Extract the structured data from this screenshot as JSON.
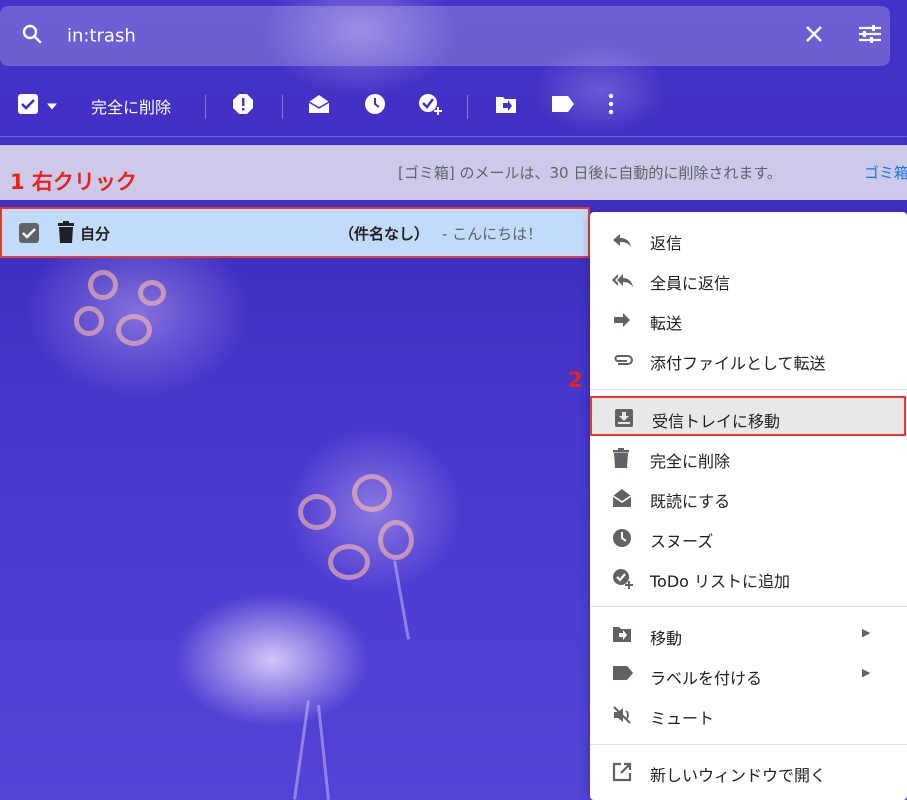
{
  "search": {
    "query": "in:trash"
  },
  "toolbar": {
    "delete_forever_label": "完全に削除"
  },
  "notice": {
    "text": "[ゴミ箱] のメールは、30 日後に自動的に削除されます。",
    "link": "ゴミ箱"
  },
  "annotations": {
    "step1": "1 右クリック",
    "step2": "2"
  },
  "email": {
    "sender": "自分",
    "subject": "（件名なし）",
    "snippet": "- こんにちは！"
  },
  "menu": {
    "items": [
      {
        "label": "返信",
        "icon": "reply-icon"
      },
      {
        "label": "全員に返信",
        "icon": "reply-all-icon"
      },
      {
        "label": "転送",
        "icon": "forward-icon"
      },
      {
        "label": "添付ファイルとして転送",
        "icon": "attachment-icon"
      },
      {
        "label": "受信トレイに移動",
        "icon": "move-to-inbox-icon"
      },
      {
        "label": "完全に削除",
        "icon": "trash-icon"
      },
      {
        "label": "既読にする",
        "icon": "mark-read-icon"
      },
      {
        "label": "スヌーズ",
        "icon": "clock-icon"
      },
      {
        "label": "ToDo リストに追加",
        "icon": "add-task-icon"
      },
      {
        "label": "移動",
        "icon": "move-to-icon"
      },
      {
        "label": "ラベルを付ける",
        "icon": "label-icon"
      },
      {
        "label": "ミュート",
        "icon": "mute-icon"
      },
      {
        "label": "新しいウィンドウで開く",
        "icon": "open-in-new-icon"
      }
    ]
  },
  "colors": {
    "annotation": "#e53935",
    "selected_row": "#c2dbfb",
    "link": "#1a73e8"
  }
}
